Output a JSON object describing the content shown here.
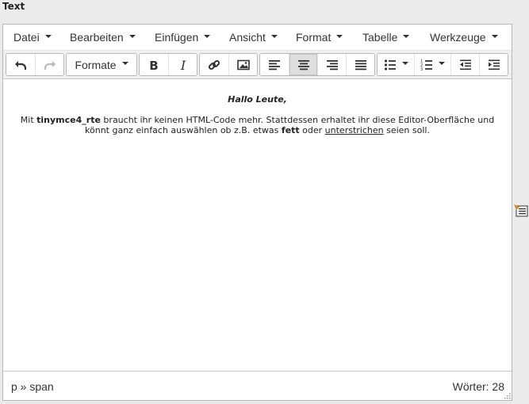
{
  "field": {
    "label": "Text"
  },
  "menubar": {
    "items": [
      "Datei",
      "Bearbeiten",
      "Einfügen",
      "Ansicht",
      "Format",
      "Tabelle",
      "Werkzeuge"
    ]
  },
  "toolbar": {
    "formats_label": "Formate",
    "icons": {
      "undo": "undo-icon",
      "redo": "redo-icon",
      "bold": "bold-icon",
      "italic": "italic-icon",
      "link": "link-icon",
      "image": "image-icon",
      "align_left": "align-left-icon",
      "align_center": "align-center-icon",
      "align_right": "align-right-icon",
      "align_justify": "align-justify-icon",
      "bullet_list": "bullet-list-icon",
      "numbered_list": "numbered-list-icon",
      "outdent": "outdent-icon",
      "indent": "indent-icon"
    },
    "active": "align_center"
  },
  "content": {
    "greeting": "Hallo Leute,",
    "para_1": "Mit ",
    "para_bold_1": "tinymce4_rte",
    "para_2": " braucht ihr keinen HTML-Code mehr. Stattdessen erhaltet ihr diese Editor-Oberfläche und könnt ganz einfach auswählen ob z.B. etwas ",
    "para_bold_2": "fett",
    "para_3": " oder ",
    "para_underline": "unterstrichen",
    "para_4": " seien soll."
  },
  "statusbar": {
    "path": "p » span",
    "wordcount": "Wörter: 28"
  },
  "colors": {
    "background": "#ebebeb",
    "toolbar": "#f0f0f0",
    "border": "#b6b6b6",
    "active_button": "#dedede",
    "text": "#333333"
  }
}
